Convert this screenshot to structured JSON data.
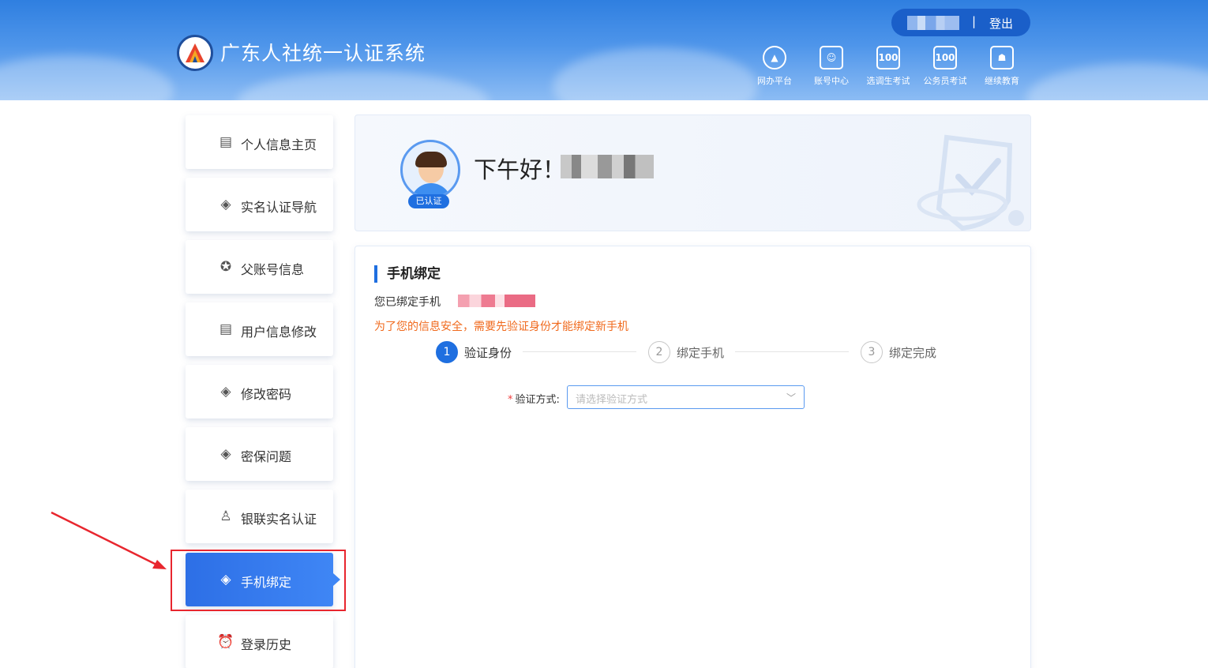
{
  "header": {
    "brand": "广东人社统一认证系统",
    "separator": "|",
    "logout": "登出",
    "nav": [
      {
        "label": "网办平台",
        "icon": "portal-icon",
        "glyph": "▲"
      },
      {
        "label": "账号中心",
        "icon": "account-center-icon",
        "glyph": "☺"
      },
      {
        "label": "选调生考试",
        "icon": "exam-icon",
        "glyph": "100"
      },
      {
        "label": "公务员考试",
        "icon": "civil-exam-icon",
        "glyph": "100"
      },
      {
        "label": "继续教育",
        "icon": "education-icon",
        "glyph": "☗"
      }
    ]
  },
  "sidebar": {
    "items": [
      {
        "label": "个人信息主页",
        "icon": "id-card-icon",
        "glyph": "▤"
      },
      {
        "label": "实名认证导航",
        "icon": "shield-check-icon",
        "glyph": "◈"
      },
      {
        "label": "父账号信息",
        "icon": "badge-icon",
        "glyph": "✪"
      },
      {
        "label": "用户信息修改",
        "icon": "id-card-icon",
        "glyph": "▤"
      },
      {
        "label": "修改密码",
        "icon": "shield-check-icon",
        "glyph": "◈"
      },
      {
        "label": "密保问题",
        "icon": "shield-check-icon",
        "glyph": "◈"
      },
      {
        "label": "银联实名认证",
        "icon": "user-stamp-icon",
        "glyph": "♙"
      },
      {
        "label": "手机绑定",
        "icon": "shield-check-icon",
        "glyph": "◈"
      },
      {
        "label": "登录历史",
        "icon": "alarm-clock-icon",
        "glyph": "⏰"
      }
    ]
  },
  "welcome": {
    "greeting": "下午好！",
    "verified_badge": "已认证"
  },
  "main": {
    "title": "手机绑定",
    "bound_phone_label": "您已绑定手机",
    "warning": "为了您的信息安全，需要先验证身份才能绑定新手机",
    "steps": [
      {
        "num": "1",
        "label": "验证身份"
      },
      {
        "num": "2",
        "label": "绑定手机"
      },
      {
        "num": "3",
        "label": "绑定完成"
      }
    ],
    "form": {
      "required_mark": "*",
      "label": "验证方式:",
      "placeholder": "请选择验证方式"
    }
  },
  "colors": {
    "accent": "#1f6fe0",
    "warning": "#f06a1d",
    "highlight": "#e8262e"
  }
}
